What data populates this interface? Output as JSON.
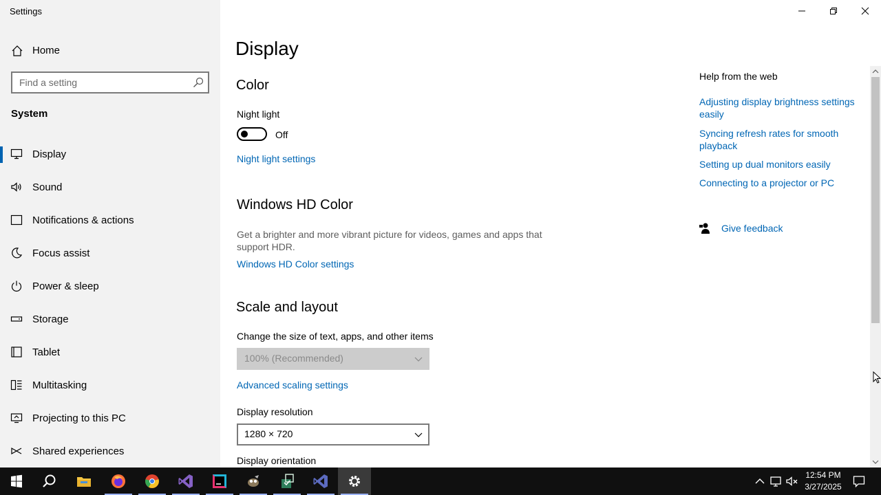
{
  "window": {
    "title": "Settings",
    "controls": {
      "minimize": "minimize",
      "restore": "restore",
      "close": "close"
    }
  },
  "sidebar": {
    "home_label": "Home",
    "search": {
      "placeholder": "Find a setting",
      "value": ""
    },
    "section_label": "System",
    "items": [
      {
        "label": "Display",
        "icon": "monitor-icon",
        "active": true
      },
      {
        "label": "Sound",
        "icon": "speaker-icon"
      },
      {
        "label": "Notifications & actions",
        "icon": "notifications-icon"
      },
      {
        "label": "Focus assist",
        "icon": "moon-icon"
      },
      {
        "label": "Power & sleep",
        "icon": "power-icon"
      },
      {
        "label": "Storage",
        "icon": "storage-icon"
      },
      {
        "label": "Tablet",
        "icon": "tablet-icon"
      },
      {
        "label": "Multitasking",
        "icon": "multitasking-icon"
      },
      {
        "label": "Projecting to this PC",
        "icon": "projecting-icon"
      },
      {
        "label": "Shared experiences",
        "icon": "shared-icon"
      }
    ]
  },
  "main": {
    "title": "Display",
    "color": {
      "heading": "Color",
      "night_light_label": "Night light",
      "night_light_state": "Off",
      "night_light_on": false,
      "night_light_settings_link": "Night light settings"
    },
    "hd_color": {
      "heading": "Windows HD Color",
      "description": "Get a brighter and more vibrant picture for videos, games and apps that support HDR.",
      "settings_link": "Windows HD Color settings"
    },
    "scale_layout": {
      "heading": "Scale and layout",
      "size_label": "Change the size of text, apps, and other items",
      "size_value": "100% (Recommended)",
      "size_disabled": true,
      "advanced_link": "Advanced scaling settings",
      "resolution_label": "Display resolution",
      "resolution_value": "1280 × 720",
      "orientation_label": "Display orientation"
    }
  },
  "help": {
    "heading": "Help from the web",
    "links": [
      "Adjusting display brightness settings easily",
      "Syncing refresh rates for smooth playback",
      "Setting up dual monitors easily",
      "Connecting to a projector or PC"
    ],
    "feedback_label": "Give feedback"
  },
  "taskbar": {
    "apps": [
      "start-icon",
      "search-icon",
      "file-explorer-icon",
      "firefox-icon",
      "chromium-icon",
      "visual-studio-icon",
      "jetbrains-icon",
      "gimp-icon",
      "app-installer-icon",
      "visual-studio-preview-icon",
      "settings-gear-icon"
    ],
    "tray": [
      "chevron-up-icon",
      "network-icon",
      "volume-muted-icon"
    ],
    "time": "12:54 PM",
    "date": "3/27/2025"
  },
  "colors": {
    "accent": "#0063b1",
    "link": "#0066b4",
    "taskbar": "#101010",
    "sidebar": "#f2f2f2"
  }
}
